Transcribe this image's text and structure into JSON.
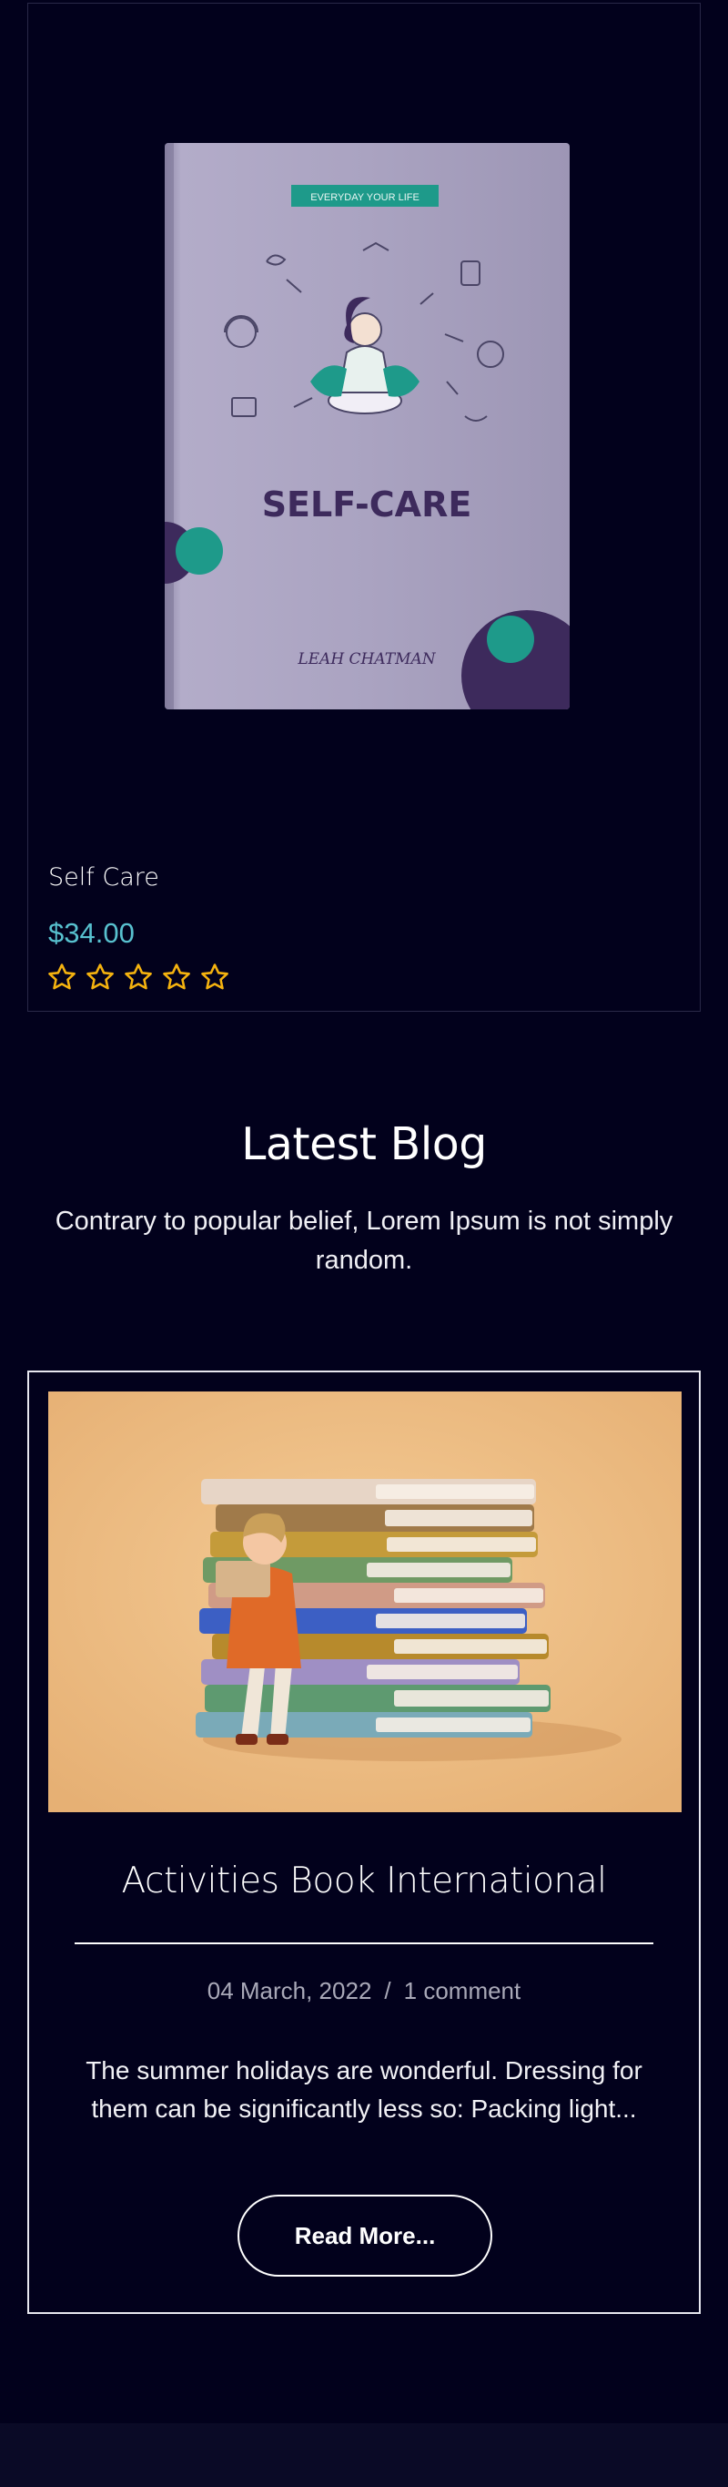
{
  "product": {
    "title": "Self Care",
    "price": "$34.00",
    "rating": {
      "filled": 0,
      "total": 5
    },
    "cover": {
      "banner": "EVERYDAY YOUR LIFE",
      "title": "SELF-CARE",
      "author": "LEAH CHATMAN",
      "colors": {
        "cover": "#a9a2c0",
        "teal": "#1e9a8a",
        "purple": "#3d2a5c"
      }
    }
  },
  "blog_section": {
    "heading": "Latest Blog",
    "subtitle": "Contrary to popular belief, Lorem Ipsum is not simply random."
  },
  "blog_post": {
    "title": "Activities Book International",
    "date": "04 March, 2022",
    "separator": "/",
    "comments": "1 comment",
    "excerpt": "The summer holidays are wonderful. Dressing for them can be significantly less so: Packing light...",
    "read_more_label": "Read More..."
  },
  "colors": {
    "background": "#02011c",
    "price": "#58c1cf",
    "star": "#f5b30f",
    "blog_image_bg": "#e9b87c"
  }
}
